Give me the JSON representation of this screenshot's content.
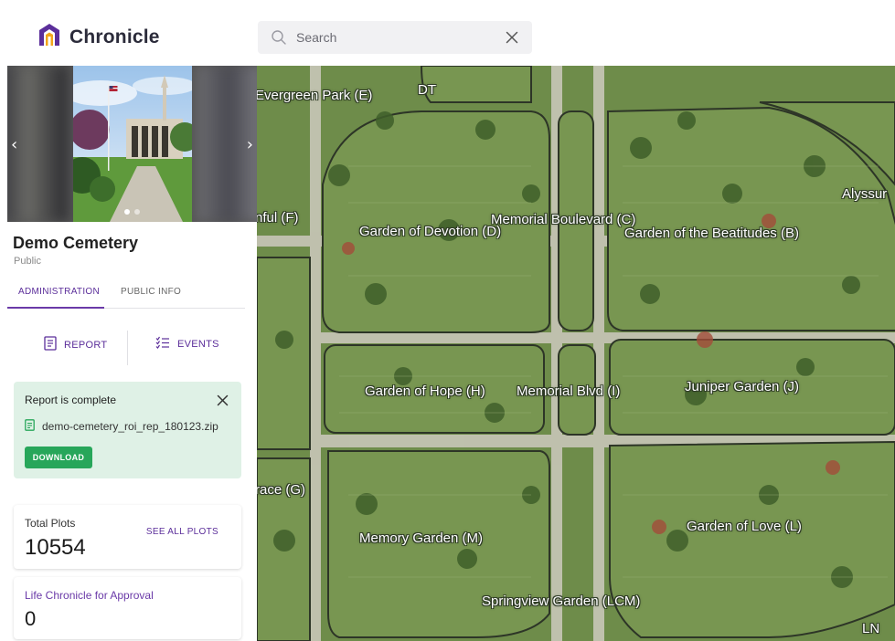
{
  "app": {
    "name": "Chronicle",
    "brand_color": "#5b2e9a",
    "logo_icon": "chronicle-logo-icon"
  },
  "search": {
    "placeholder": "Search",
    "value": "",
    "icon": "search-icon",
    "clear_icon": "close-icon"
  },
  "site": {
    "title": "Demo Cemetery",
    "subtitle": "Public"
  },
  "carousel": {
    "slide_count": 2,
    "active_slide": 1
  },
  "tabs": [
    {
      "label": "ADMINISTRATION",
      "active": true
    },
    {
      "label": "PUBLIC INFO",
      "active": false
    }
  ],
  "actions": {
    "report_label": "REPORT",
    "events_label": "EVENTS"
  },
  "report": {
    "title": "Report is complete",
    "file_name": "demo-cemetery_roi_rep_180123.zip",
    "download_label": "DOWNLOAD",
    "bg_color": "#dff1e6",
    "button_color": "#27a65a"
  },
  "stats": {
    "plots_label": "Total Plots",
    "plots_value": "10554",
    "plots_link": "SEE ALL PLOTS",
    "approval_label": "Life Chronicle for Approval",
    "approval_value": "0"
  },
  "map": {
    "sections": [
      {
        "name": "Evergreen Park (E)"
      },
      {
        "name": "DT"
      },
      {
        "name": "nful (F)"
      },
      {
        "name": "Garden of Devotion (D)"
      },
      {
        "name": "Memorial Boulevard (C)"
      },
      {
        "name": "Garden of the Beatitudes (B)"
      },
      {
        "name": "Alyssur"
      },
      {
        "name": "Garden of Hope (H)"
      },
      {
        "name": "Memorial Blvd (I)"
      },
      {
        "name": "Juniper Garden (J)"
      },
      {
        "name": "race (G)"
      },
      {
        "name": "Memory Garden (M)"
      },
      {
        "name": "Garden of Love (L)"
      },
      {
        "name": "Springview Garden (LCM)"
      },
      {
        "name": "LN"
      }
    ]
  }
}
